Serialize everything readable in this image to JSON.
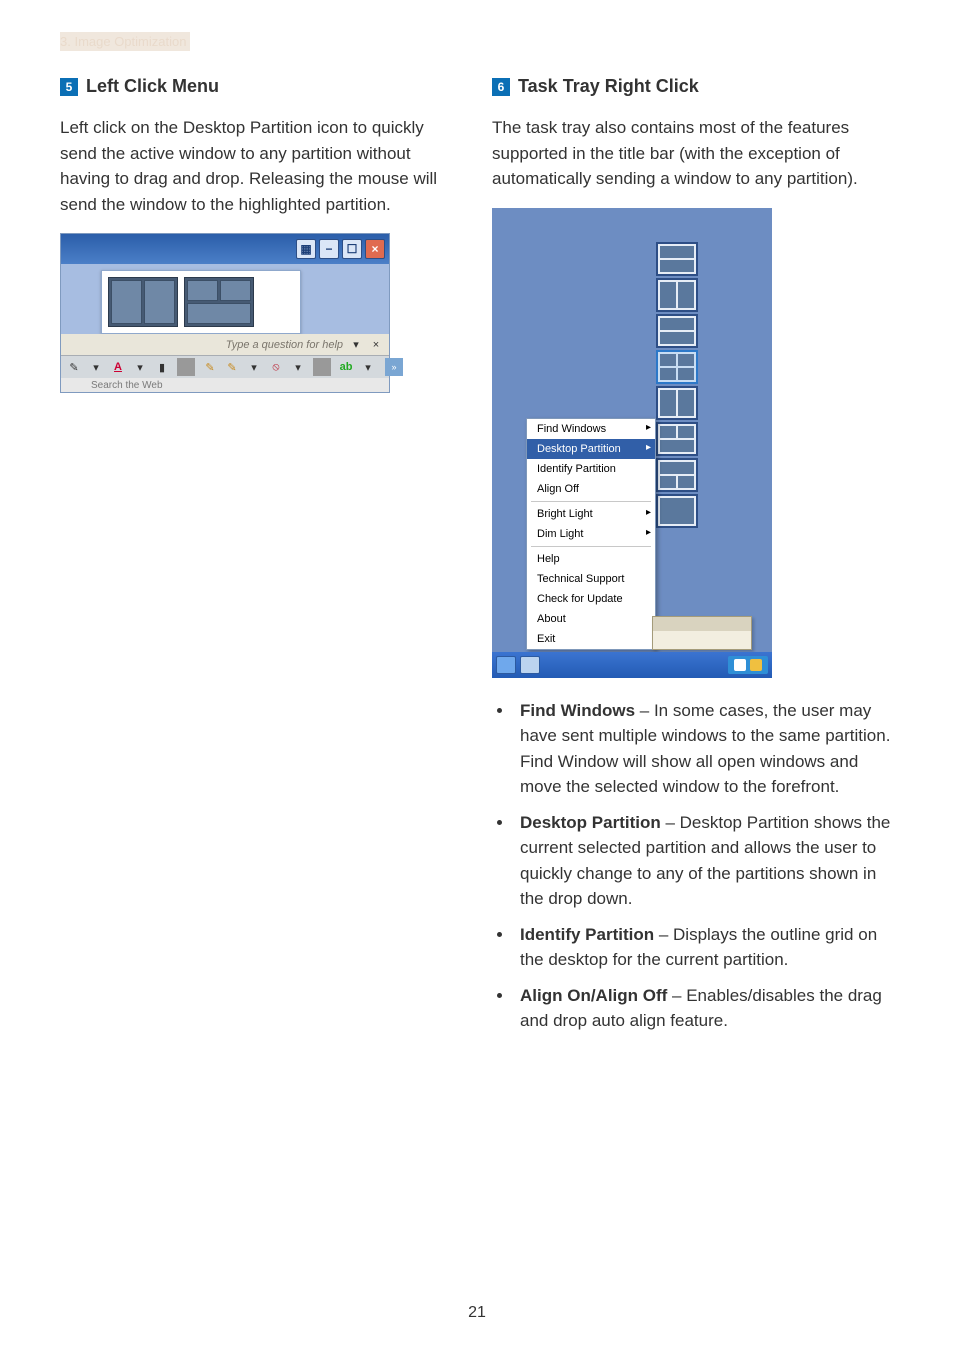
{
  "breadcrumb": "3. Image Optimization",
  "page_number": "21",
  "left": {
    "step": "5",
    "title": "Left Click Menu",
    "paragraph": "Left click on the Desktop Partition icon to quickly send the active window to any partition without having to drag and drop. Releasing the mouse will send the window to the highlighted partition.",
    "help_text": "Type a question for help",
    "toolbar": {
      "a": "A",
      "ab": "ab"
    },
    "footer_fragment": "Search the Web"
  },
  "right": {
    "step": "6",
    "title": "Task Tray Right Click",
    "paragraph": "The task tray also contains most of the features supported in the title bar (with the exception of automatically sending a window to any partition).",
    "menu": {
      "find_windows": "Find Windows",
      "desktop_partition": "Desktop Partition",
      "identify_partition": "Identify Partition",
      "align_off": "Align Off",
      "bright_light": "Bright Light",
      "dim_light": "Dim Light",
      "help": "Help",
      "technical_support": "Technical Support",
      "check_update": "Check for Update",
      "about": "About",
      "exit": "Exit"
    },
    "bullets": [
      {
        "term": "Find Windows",
        "desc": " – In some cases, the user may have sent multiple windows to the same partition.  Find Window will show all open windows and move the selected window to the forefront."
      },
      {
        "term": "Desktop Partition",
        "desc": " – Desktop Partition shows the current selected partition and allows the user to quickly change to any of the partitions shown in the drop down."
      },
      {
        "term": "Identify Partition",
        "desc": " – Displays the outline grid on the desktop for the current partition."
      },
      {
        "term": "Align On/Align Off",
        "desc": " – Enables/disables the drag and drop auto align feature."
      }
    ]
  }
}
